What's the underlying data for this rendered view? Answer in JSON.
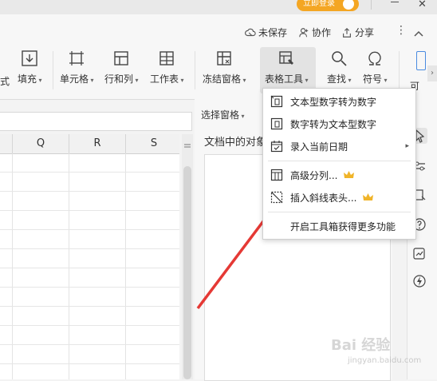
{
  "titlebar": {
    "login_label": "立即登录"
  },
  "top_actions": {
    "unsaved": "未保存",
    "collab": "协作",
    "share": "分享"
  },
  "ribbon": {
    "items": [
      {
        "label": "填充",
        "icon": "fill-down-icon"
      },
      {
        "label": "单元格",
        "icon": "cell-icon"
      },
      {
        "label": "行和列",
        "icon": "rows-columns-icon"
      },
      {
        "label": "工作表",
        "icon": "worksheet-icon"
      },
      {
        "label": "冻结窗格",
        "icon": "freeze-panes-icon"
      },
      {
        "label": "表格工具",
        "icon": "table-tools-icon"
      },
      {
        "label": "查找",
        "icon": "search-icon"
      },
      {
        "label": "符号",
        "icon": "omega-icon"
      }
    ],
    "partial_left": "式",
    "partial_right": "可"
  },
  "sheet": {
    "columns": [
      "Q",
      "R",
      "S"
    ]
  },
  "selection_pane": {
    "title": "选择窗格",
    "objects_label": "文档中的对象"
  },
  "table_tools_menu": {
    "items": [
      {
        "label": "文本型数字转为数字",
        "icon": "text-to-number-icon"
      },
      {
        "label": "数字转为文本型数字",
        "icon": "number-to-text-icon"
      },
      {
        "label": "录入当前日期",
        "icon": "calendar-check-icon",
        "submenu": true
      },
      {
        "label": "高级分列...",
        "icon": "split-columns-icon",
        "premium": true
      },
      {
        "label": "插入斜线表头...",
        "icon": "diagonal-header-icon",
        "premium": true
      },
      {
        "label": "开启工具箱获得更多功能"
      }
    ]
  },
  "watermark": {
    "text": "Bai 经验",
    "url": "jingyan.baidu.com"
  },
  "colors": {
    "accent": "#f4a623",
    "arrow": "#e53935",
    "crown": "#f0b429"
  }
}
